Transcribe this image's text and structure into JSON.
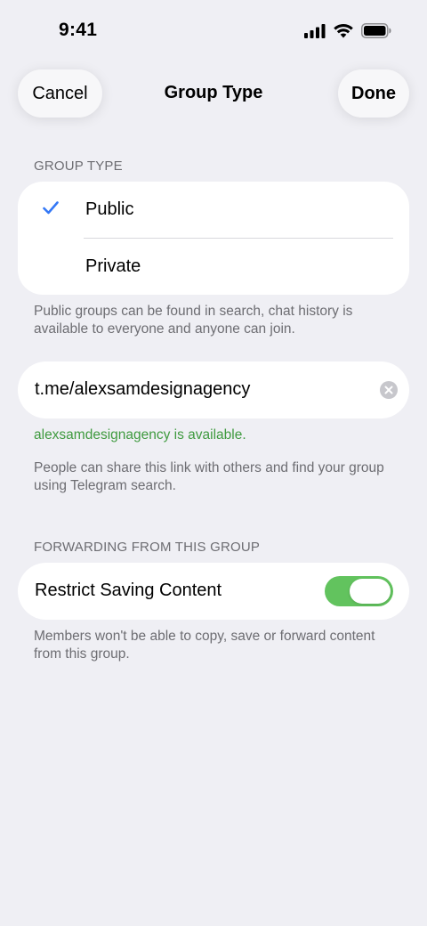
{
  "status_bar": {
    "time": "9:41"
  },
  "nav": {
    "cancel_label": "Cancel",
    "title": "Group Type",
    "done_label": "Done"
  },
  "group_type": {
    "header": "GROUP TYPE",
    "options": [
      {
        "label": "Public",
        "selected": true
      },
      {
        "label": "Private",
        "selected": false
      }
    ],
    "footnote": "Public groups can be found in search, chat history is available to everyone and anyone can join."
  },
  "link": {
    "value": "t.me/alexsamdesignagency",
    "availability": "alexsamdesignagency is available.",
    "footnote": "People can share this link with others and find your group using Telegram search."
  },
  "forwarding": {
    "header": "FORWARDING FROM THIS GROUP",
    "restrict_label": "Restrict Saving Content",
    "restrict_enabled": true,
    "footnote": "Members won't be able to copy, save or forward content from this group."
  },
  "colors": {
    "accent": "#3478f6",
    "toggle_on": "#62c35e",
    "available_text": "#3f9a3f",
    "background": "#efeff4"
  },
  "icons": [
    "signal-icon",
    "wifi-icon",
    "battery-icon",
    "checkmark-icon",
    "clear-icon"
  ]
}
